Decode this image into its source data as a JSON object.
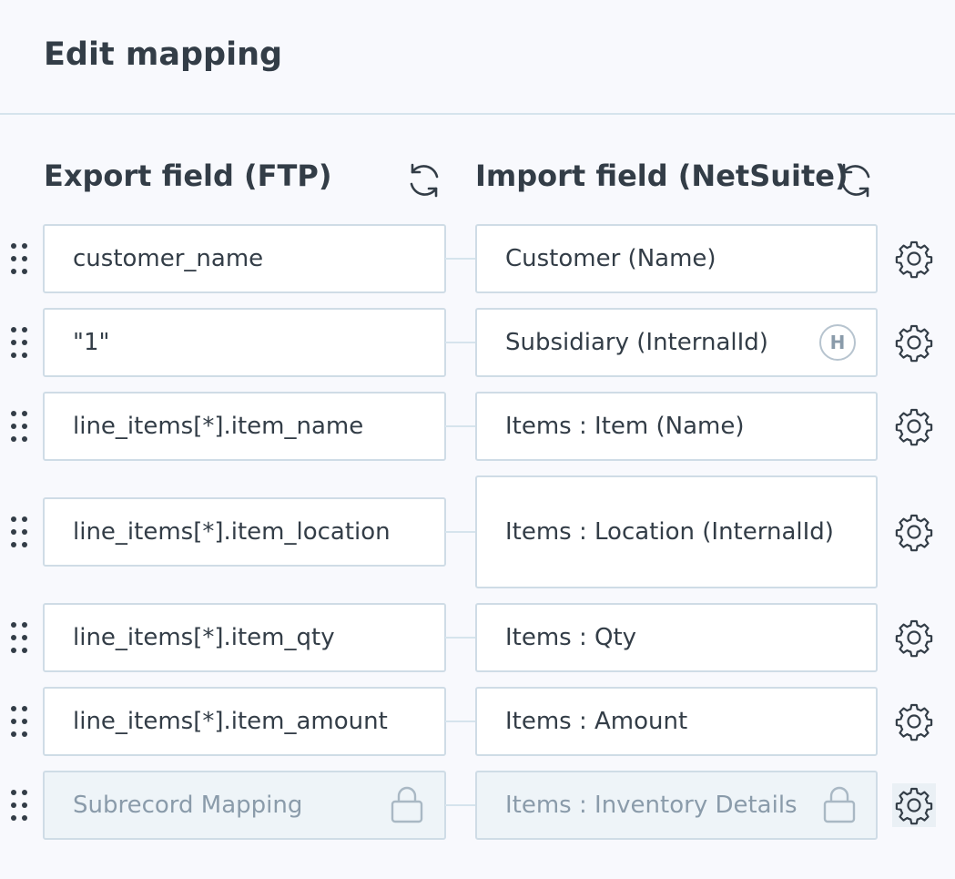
{
  "header": {
    "title": "Edit mapping"
  },
  "columns": {
    "export_label": "Export field (FTP)",
    "import_label": "Import field (NetSuite)"
  },
  "rows": [
    {
      "export": "customer_name",
      "import": "Customer (Name)"
    },
    {
      "export": "\"1\"",
      "import": "Subsidiary (InternalId)",
      "badge": "H"
    },
    {
      "export": "line_items[*].item_name",
      "import": "Items : Item (Name)"
    },
    {
      "export": "line_items[*].item_location",
      "import": "Items : Location (InternalId)"
    },
    {
      "export": "line_items[*].item_qty",
      "import": "Items : Qty"
    },
    {
      "export": "line_items[*].item_amount",
      "import": "Items : Amount"
    },
    {
      "export": "Subrecord Mapping",
      "import": "Items : Inventory Details",
      "locked": true
    }
  ],
  "icons": {
    "refresh": "refresh-icon",
    "drag": "drag-handle-icon",
    "settings": "gear-icon",
    "lock": "lock-icon",
    "hardcoded": "hardcoded-badge"
  },
  "colors": {
    "background": "#f8f9fd",
    "text": "#333d47",
    "border": "#cfdce6",
    "locked_bg": "#eef4f8",
    "locked_text": "#8a9baa"
  }
}
